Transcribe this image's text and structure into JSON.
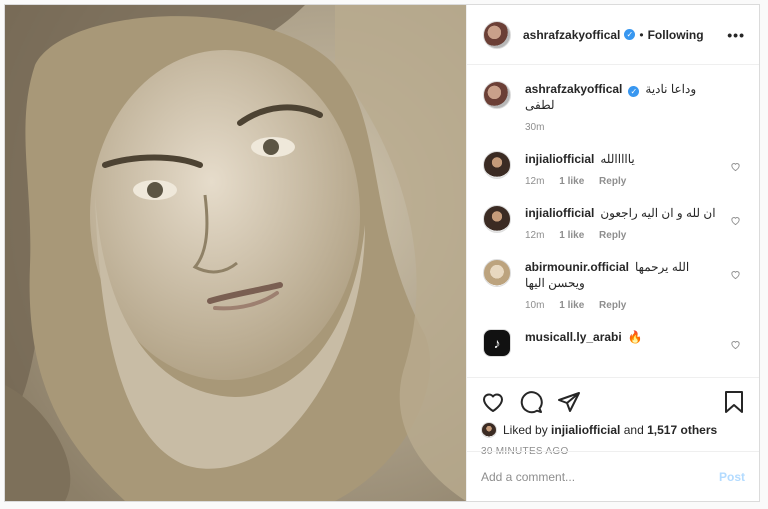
{
  "post": {
    "username": "ashrafzakyoffical",
    "following_label": "Following",
    "more_label": "•••"
  },
  "caption": {
    "username": "ashrafzakyoffical",
    "text": "وداعا نادية لطفى",
    "time": "30m"
  },
  "comments": [
    {
      "username": "injialiofficial",
      "text": "يااااالله",
      "time": "12m",
      "likes": "1 like",
      "reply": "Reply"
    },
    {
      "username": "injialiofficial",
      "text": "ان لله و ان اليه راجعون",
      "time": "12m",
      "likes": "1 like",
      "reply": "Reply"
    },
    {
      "username": "abirmounir.official",
      "text": "الله يرحمها ويحسن اليها",
      "time": "10m",
      "likes": "1 like",
      "reply": "Reply"
    },
    {
      "username": "musicall.ly_arabi",
      "text": "🔥"
    }
  ],
  "likes": {
    "prefix": "Liked by",
    "user": "injialiofficial",
    "conj": "and",
    "others": "1,517 others"
  },
  "time_ago": "30 MINUTES AGO",
  "add_comment": {
    "placeholder": "Add a comment...",
    "post_label": "Post"
  },
  "colors": {
    "verified": "#3897f0",
    "muted": "#8e8e8e",
    "post_button": "#b3dbff"
  }
}
